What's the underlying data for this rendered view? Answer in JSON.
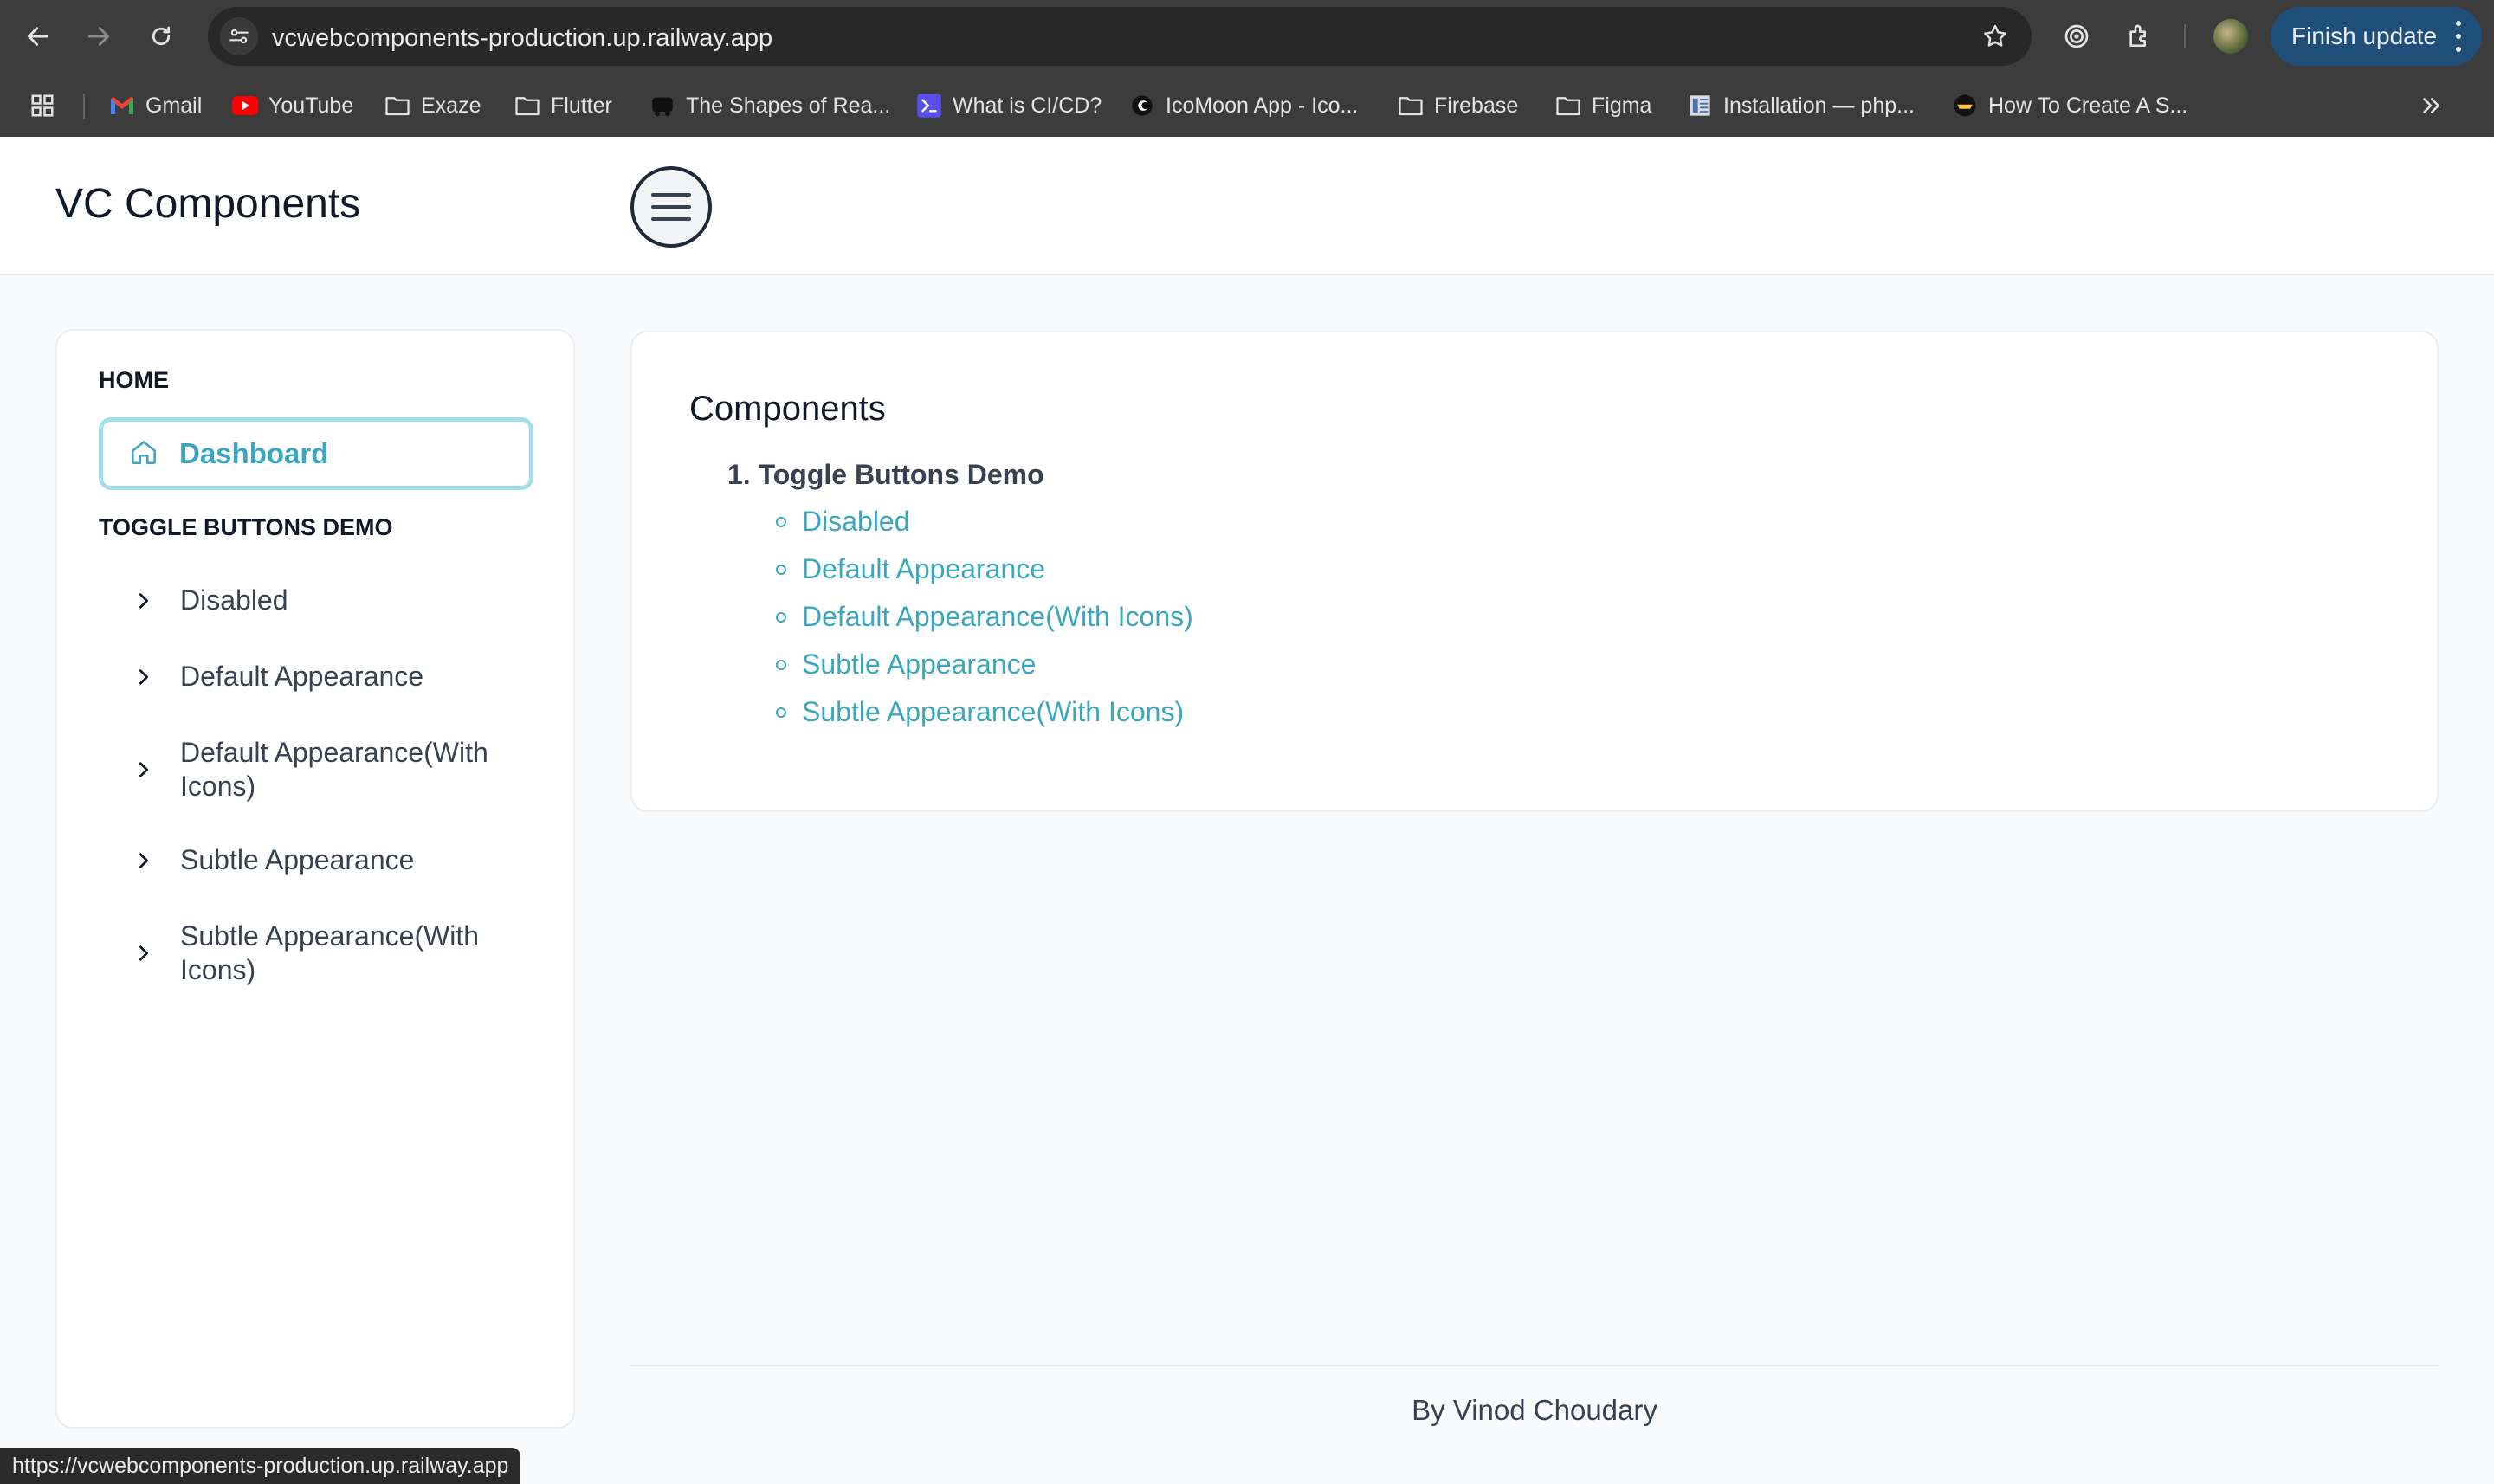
{
  "browser": {
    "url": "vcwebcomponents-production.up.railway.app",
    "finish_update": "Finish update",
    "bookmarks": [
      {
        "label": "Gmail",
        "icon": "gmail-icon"
      },
      {
        "label": "YouTube",
        "icon": "youtube-icon"
      },
      {
        "label": "Exaze",
        "icon": "folder-icon"
      },
      {
        "label": "Flutter",
        "icon": "folder-icon"
      },
      {
        "label": "The Shapes of Rea...",
        "icon": "site-icon"
      },
      {
        "label": "What is CI/CD?",
        "icon": "terminal-icon"
      },
      {
        "label": "IcoMoon App - Ico...",
        "icon": "icomoon-icon"
      },
      {
        "label": "Firebase",
        "icon": "folder-icon"
      },
      {
        "label": "Figma",
        "icon": "folder-icon"
      },
      {
        "label": "Installation — php...",
        "icon": "doc-icon"
      },
      {
        "label": "How To Create A S...",
        "icon": "site-icon"
      }
    ],
    "status_url": "https://vcwebcomponents-production.up.railway.app"
  },
  "header": {
    "brand": "VC Components"
  },
  "sidebar": {
    "home_title": "HOME",
    "dashboard_label": "Dashboard",
    "demo_title": "TOGGLE BUTTONS DEMO",
    "items": [
      {
        "label": "Disabled"
      },
      {
        "label": "Default Appearance"
      },
      {
        "label": "Default Appearance(With Icons)"
      },
      {
        "label": "Subtle Appearance"
      },
      {
        "label": "Subtle Appearance(With Icons)"
      }
    ]
  },
  "main": {
    "title": "Components",
    "list_item": "1. Toggle Buttons Demo",
    "links": [
      {
        "label": "Disabled"
      },
      {
        "label": "Default Appearance"
      },
      {
        "label": "Default Appearance(With Icons)"
      },
      {
        "label": "Subtle Appearance"
      },
      {
        "label": "Subtle Appearance(With Icons)"
      }
    ]
  },
  "footer": {
    "text": "By Vinod Choudary"
  },
  "colors": {
    "accent": "#3aa6c0",
    "accent_border": "#a5ddea",
    "chrome_bg": "#3c3c3c",
    "finish_update_bg": "#1f4e79"
  }
}
